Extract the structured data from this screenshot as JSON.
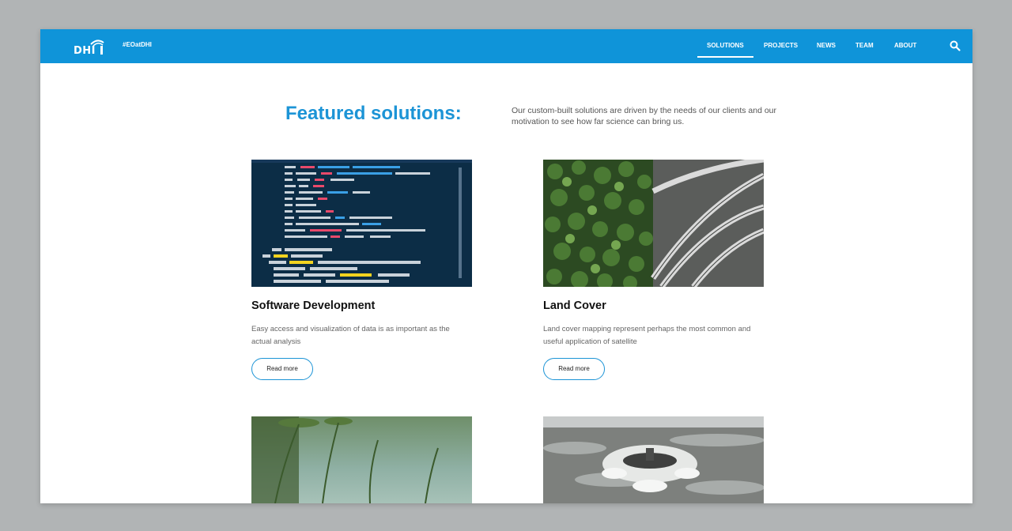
{
  "header": {
    "logo_text": "DHI",
    "hashtag": "#EOatDHI",
    "nav": [
      "SOLUTIONS",
      "PROJECTS",
      "NEWS",
      "TEAM",
      "ABOUT"
    ],
    "active_nav": "SOLUTIONS",
    "search_icon": "search-icon"
  },
  "main": {
    "heading": "Featured solutions:",
    "intro": "Our custom-built solutions are driven by the needs of our clients and our motivation to see how far science can bring us."
  },
  "cards": [
    {
      "title": "Software Development",
      "description": "Easy access and visualization of data is as important as the actual analysis",
      "button": "Read more",
      "image": "code-screenshot"
    },
    {
      "title": "Land Cover",
      "description": "Land cover mapping represent perhaps the most common and useful application of satellite",
      "button": "Read more",
      "image": "forest-and-highway"
    },
    {
      "image": "underwater-plants"
    },
    {
      "image": "water-outflow"
    }
  ],
  "colors": {
    "brand_blue": "#0f94d9",
    "heading_blue": "#1c94d6",
    "backdrop": "#b1b4b5"
  }
}
